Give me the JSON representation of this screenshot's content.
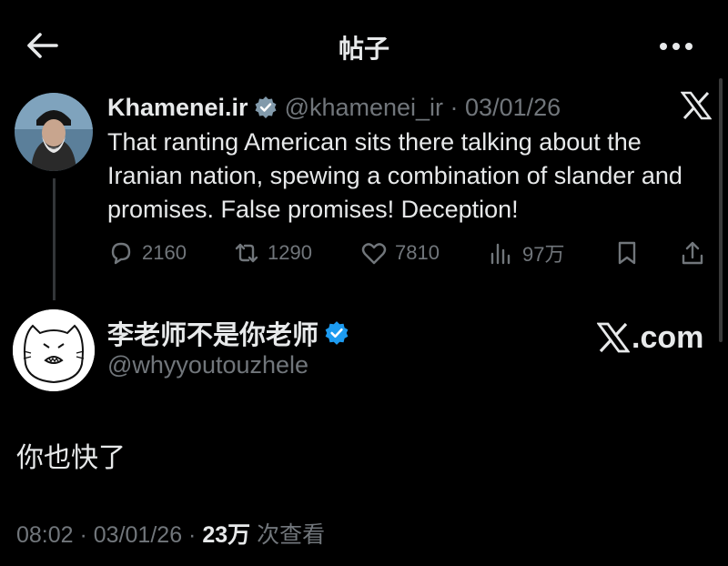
{
  "header": {
    "title": "帖子"
  },
  "quoted_post": {
    "author_name": "Khamenei.ir",
    "meta": "@khamenei_ir · 03/01/26",
    "text": "That ranting American sits there talking about the Iranian nation, spewing a combination of slander and promises. False promises! Deception!",
    "replies": "2160",
    "reposts": "1290",
    "likes": "7810",
    "views": "97万"
  },
  "post": {
    "author_name": "李老师不是你老师",
    "handle": "@whyyoutouzhele",
    "source_badge": ".com",
    "text": "你也快了",
    "time_date": "08:02 · 03/01/26 · ",
    "views_count": "23万",
    "views_label": " 次查看"
  },
  "colors": {
    "verified": "#1d9bf0",
    "muted": "#71767b",
    "text": "#e7e9ea"
  }
}
